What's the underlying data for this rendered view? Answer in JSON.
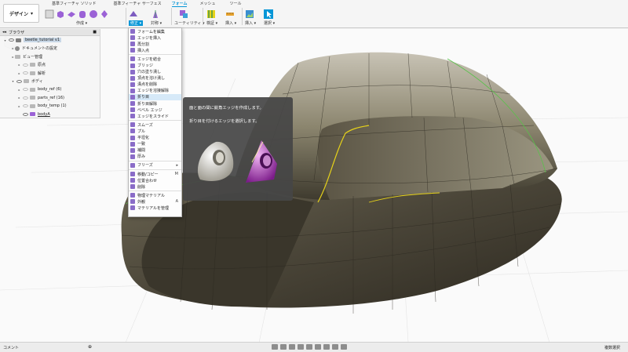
{
  "workspace": {
    "label": "デザイン"
  },
  "tabs": [
    {
      "label": "基準フィーチャ ソリッド",
      "active": false
    },
    {
      "label": "基準フィーチャ サーフェス",
      "active": false
    },
    {
      "label": "フォーム",
      "active": true
    },
    {
      "label": "メッシュ",
      "active": false
    },
    {
      "label": "ツール",
      "active": false
    }
  ],
  "toolbar": {
    "create_label": "作成",
    "modify_label": "修正",
    "symmetry_label": "対称",
    "utility_label": "ユーティリティ",
    "inspect_label": "検証",
    "assemble_label": "挿入",
    "insert_label": "挿入",
    "select_label": "選択"
  },
  "browser": {
    "title": "ブラウザ",
    "items": [
      {
        "label": "beetle_tutorial v1",
        "level": 0
      },
      {
        "label": "ドキュメントの設定",
        "level": 1
      },
      {
        "label": "ビュー管理",
        "level": 1
      },
      {
        "label": "原点",
        "level": 2
      },
      {
        "label": "解析",
        "level": 2
      },
      {
        "label": "ボディ",
        "level": 1
      },
      {
        "label": "body_ref (6)",
        "level": 2
      },
      {
        "label": "parts_ref (16)",
        "level": 2
      },
      {
        "label": "body_temp (1)",
        "level": 2
      },
      {
        "label": "bodyA",
        "level": 2
      }
    ]
  },
  "menu": {
    "items": [
      {
        "label": "フォームを編集",
        "shortcut": ""
      },
      {
        "label": "エッジを挿入",
        "shortcut": ""
      },
      {
        "label": "再分割",
        "shortcut": ""
      },
      {
        "label": "挿入点",
        "shortcut": ""
      },
      {
        "sep": true
      },
      {
        "label": "エッジを結合",
        "shortcut": ""
      },
      {
        "label": "ブリッジ",
        "shortcut": ""
      },
      {
        "label": "穴の塗り潰し",
        "shortcut": ""
      },
      {
        "label": "頂点を溶け潰し",
        "shortcut": ""
      },
      {
        "label": "溝点を削除",
        "shortcut": ""
      },
      {
        "label": "エッジを溶接解除",
        "shortcut": ""
      },
      {
        "label": "折り目",
        "shortcut": "",
        "highlight": true
      },
      {
        "label": "折り目解除",
        "shortcut": ""
      },
      {
        "label": "ベベル エッジ",
        "shortcut": ""
      },
      {
        "label": "エッジをスライド",
        "shortcut": ""
      },
      {
        "sep": true
      },
      {
        "label": "スムーズ",
        "shortcut": ""
      },
      {
        "label": "プル",
        "shortcut": ""
      },
      {
        "label": "平坦化",
        "shortcut": ""
      },
      {
        "label": "一致",
        "shortcut": ""
      },
      {
        "label": "補間",
        "shortcut": ""
      },
      {
        "label": "厚み",
        "shortcut": ""
      },
      {
        "sep": true
      },
      {
        "label": "フリーズ",
        "shortcut": "▸"
      },
      {
        "sep": true
      },
      {
        "label": "移動/コピー",
        "shortcut": "M"
      },
      {
        "label": "位置合わせ",
        "shortcut": ""
      },
      {
        "label": "削除",
        "shortcut": ""
      },
      {
        "sep": true
      },
      {
        "label": "物理マテリアル",
        "shortcut": ""
      },
      {
        "label": "外観",
        "shortcut": "A"
      },
      {
        "label": "マテリアルを管理",
        "shortcut": ""
      }
    ]
  },
  "tooltip": {
    "title": "面と面の間に鋭角エッジを作成します。",
    "body": "折り目を付けるエッジを選択します。"
  },
  "bottombar": {
    "comments": "コメント",
    "select_status": "複数選択"
  },
  "colors": {
    "accent": "#0696d7",
    "model": "#4a4538",
    "highlight_edge": "#e6d21a"
  }
}
